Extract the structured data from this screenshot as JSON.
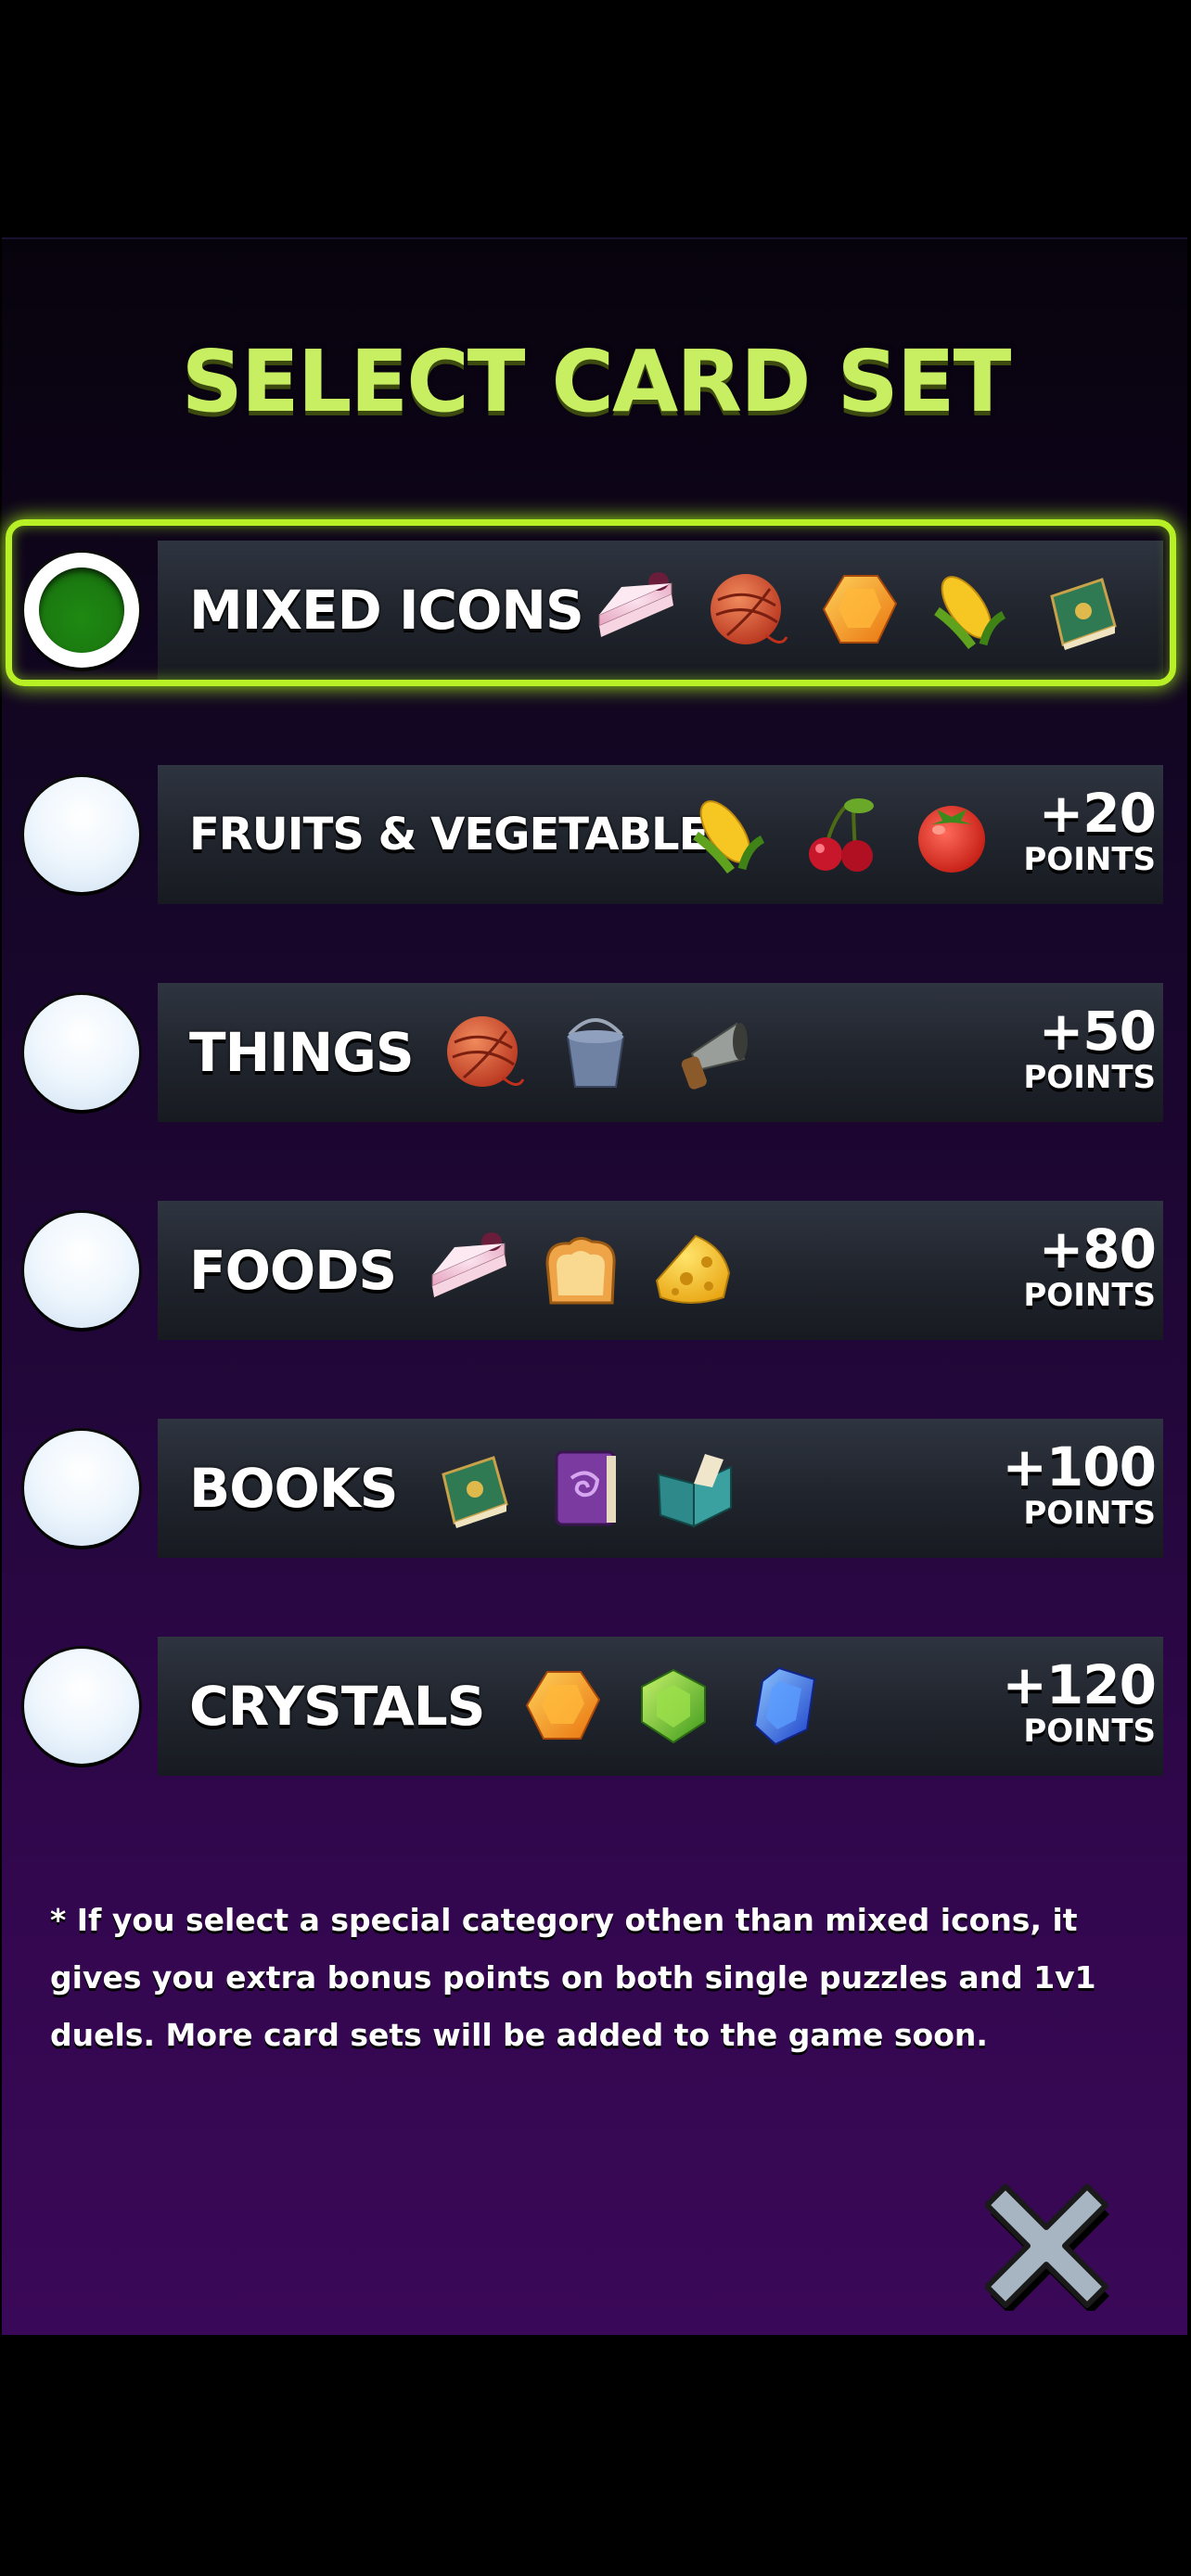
{
  "title": "SELECT CARD SET",
  "card_sets": [
    {
      "label": "MIXED ICONS",
      "selected": true,
      "points": null,
      "icons": [
        "cake-slice-icon",
        "yarn-ball-icon",
        "orange-crystal-icon",
        "corn-icon",
        "green-book-icon"
      ]
    },
    {
      "label": "FRUITS & VEGETABLES",
      "selected": false,
      "points": "+20",
      "points_unit": "POINTS",
      "icons": [
        "corn-icon",
        "cherries-icon",
        "tomato-icon"
      ]
    },
    {
      "label": "THINGS",
      "selected": false,
      "points": "+50",
      "points_unit": "POINTS",
      "icons": [
        "yarn-ball-icon",
        "bucket-icon",
        "megaphone-icon"
      ]
    },
    {
      "label": "FOODS",
      "selected": false,
      "points": "+80",
      "points_unit": "POINTS",
      "icons": [
        "cake-slice-icon",
        "bread-icon",
        "cheese-icon"
      ]
    },
    {
      "label": "BOOKS",
      "selected": false,
      "points": "+100",
      "points_unit": "POINTS",
      "icons": [
        "green-book-icon",
        "purple-spell-book-icon",
        "open-book-icon"
      ]
    },
    {
      "label": "CRYSTALS",
      "selected": false,
      "points": "+120",
      "points_unit": "POINTS",
      "icons": [
        "orange-crystal-icon",
        "green-crystal-icon",
        "blue-crystal-icon"
      ]
    }
  ],
  "note": "* If you select a special category othen than mixed icons, it gives you extra bonus points on both single puzzles and 1v1 duels. More card sets will be added to the game soon.",
  "close_icon": "close-x-icon",
  "colors": {
    "title": "#c8ef62",
    "selected_frame": "#b7f024",
    "selected_dot": "#1b7a10"
  }
}
